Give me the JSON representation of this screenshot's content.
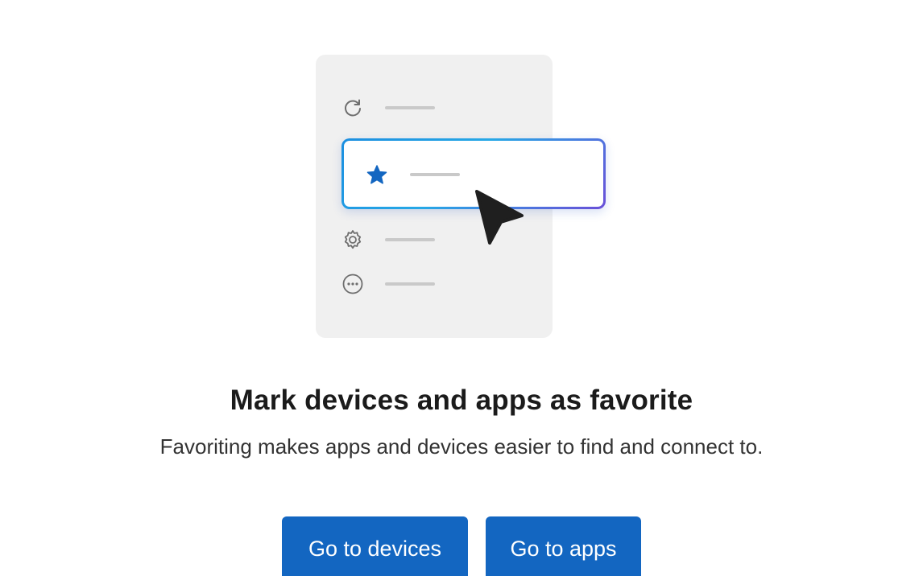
{
  "illustration": {
    "rows": [
      {
        "icon": "refresh-icon"
      },
      {
        "icon": "star-icon",
        "highlighted": true
      },
      {
        "icon": "gear-icon"
      },
      {
        "icon": "more-horizontal-icon"
      }
    ],
    "cursor_icon": "pointer-cursor-icon",
    "colors": {
      "panel": "#f0f0f0",
      "star": "#1366c1",
      "highlight_gradient_start": "#1c8fe0",
      "highlight_gradient_end": "#6a4fd8"
    }
  },
  "heading": {
    "title": "Mark devices and apps as favorite",
    "subtitle": "Favoriting makes apps and devices easier to find and connect to."
  },
  "actions": {
    "devices_label": "Go to devices",
    "apps_label": "Go to apps"
  },
  "colors": {
    "accent": "#1366c1",
    "button_text": "#ffffff"
  }
}
